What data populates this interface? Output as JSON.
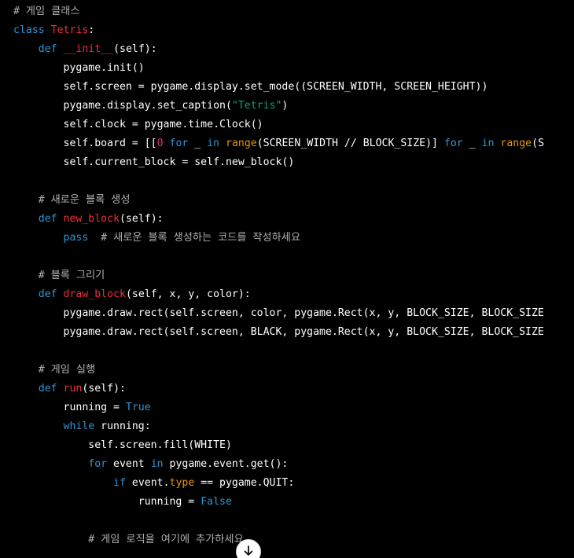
{
  "colors": {
    "background": "#000000",
    "default": "#ffffff",
    "comment": "#b0b0b0",
    "keyword": "#2e95d3",
    "class": "#f22c3d",
    "function": "#f22c3d",
    "string": "#00a67d",
    "number": "#df3079",
    "builtin": "#e9950c"
  },
  "scroll_button": {
    "icon": "arrow-down-icon"
  },
  "code": {
    "language": "python",
    "lines": [
      [
        {
          "t": "comment",
          "s": "# 게임 클래스"
        }
      ],
      [
        {
          "t": "keyword",
          "s": "class"
        },
        {
          "t": "default",
          "s": " "
        },
        {
          "t": "class",
          "s": "Tetris"
        },
        {
          "t": "default",
          "s": ":"
        }
      ],
      [
        {
          "t": "default",
          "s": "    "
        },
        {
          "t": "keyword",
          "s": "def"
        },
        {
          "t": "default",
          "s": " "
        },
        {
          "t": "func",
          "s": "__init__"
        },
        {
          "t": "default",
          "s": "(self):"
        }
      ],
      [
        {
          "t": "default",
          "s": "        pygame.init()"
        }
      ],
      [
        {
          "t": "default",
          "s": "        self.screen = pygame.display.set_mode((SCREEN_WIDTH, SCREEN_HEIGHT))"
        }
      ],
      [
        {
          "t": "default",
          "s": "        pygame.display.set_caption("
        },
        {
          "t": "string",
          "s": "\"Tetris\""
        },
        {
          "t": "default",
          "s": ")"
        }
      ],
      [
        {
          "t": "default",
          "s": "        self.clock = pygame.time.Clock()"
        }
      ],
      [
        {
          "t": "default",
          "s": "        self.board = [["
        },
        {
          "t": "number",
          "s": "0"
        },
        {
          "t": "default",
          "s": " "
        },
        {
          "t": "keyword",
          "s": "for"
        },
        {
          "t": "default",
          "s": " _ "
        },
        {
          "t": "keyword",
          "s": "in"
        },
        {
          "t": "default",
          "s": " "
        },
        {
          "t": "builtin",
          "s": "range"
        },
        {
          "t": "default",
          "s": "(SCREEN_WIDTH // BLOCK_SIZE)] "
        },
        {
          "t": "keyword",
          "s": "for"
        },
        {
          "t": "default",
          "s": " _ "
        },
        {
          "t": "keyword",
          "s": "in"
        },
        {
          "t": "default",
          "s": " "
        },
        {
          "t": "builtin",
          "s": "range"
        },
        {
          "t": "default",
          "s": "(S"
        }
      ],
      [
        {
          "t": "default",
          "s": "        self.current_block = self.new_block()"
        }
      ],
      [
        {
          "t": "default",
          "s": ""
        }
      ],
      [
        {
          "t": "default",
          "s": "    "
        },
        {
          "t": "comment",
          "s": "# 새로운 블록 생성"
        }
      ],
      [
        {
          "t": "default",
          "s": "    "
        },
        {
          "t": "keyword",
          "s": "def"
        },
        {
          "t": "default",
          "s": " "
        },
        {
          "t": "func",
          "s": "new_block"
        },
        {
          "t": "default",
          "s": "(self):"
        }
      ],
      [
        {
          "t": "default",
          "s": "        "
        },
        {
          "t": "keyword",
          "s": "pass"
        },
        {
          "t": "default",
          "s": "  "
        },
        {
          "t": "comment",
          "s": "# 새로운 블록 생성하는 코드를 작성하세요"
        }
      ],
      [
        {
          "t": "default",
          "s": ""
        }
      ],
      [
        {
          "t": "default",
          "s": "    "
        },
        {
          "t": "comment",
          "s": "# 블록 그리기"
        }
      ],
      [
        {
          "t": "default",
          "s": "    "
        },
        {
          "t": "keyword",
          "s": "def"
        },
        {
          "t": "default",
          "s": " "
        },
        {
          "t": "func",
          "s": "draw_block"
        },
        {
          "t": "default",
          "s": "(self, x, y, color):"
        }
      ],
      [
        {
          "t": "default",
          "s": "        pygame.draw.rect(self.screen, color, pygame.Rect(x, y, BLOCK_SIZE, BLOCK_SIZE"
        }
      ],
      [
        {
          "t": "default",
          "s": "        pygame.draw.rect(self.screen, BLACK, pygame.Rect(x, y, BLOCK_SIZE, BLOCK_SIZE"
        }
      ],
      [
        {
          "t": "default",
          "s": ""
        }
      ],
      [
        {
          "t": "default",
          "s": "    "
        },
        {
          "t": "comment",
          "s": "# 게임 실행"
        }
      ],
      [
        {
          "t": "default",
          "s": "    "
        },
        {
          "t": "keyword",
          "s": "def"
        },
        {
          "t": "default",
          "s": " "
        },
        {
          "t": "func",
          "s": "run"
        },
        {
          "t": "default",
          "s": "(self):"
        }
      ],
      [
        {
          "t": "default",
          "s": "        running = "
        },
        {
          "t": "keyword",
          "s": "True"
        }
      ],
      [
        {
          "t": "default",
          "s": "        "
        },
        {
          "t": "keyword",
          "s": "while"
        },
        {
          "t": "default",
          "s": " running:"
        }
      ],
      [
        {
          "t": "default",
          "s": "            self.screen.fill(WHITE)"
        }
      ],
      [
        {
          "t": "default",
          "s": "            "
        },
        {
          "t": "keyword",
          "s": "for"
        },
        {
          "t": "default",
          "s": " event "
        },
        {
          "t": "keyword",
          "s": "in"
        },
        {
          "t": "default",
          "s": " pygame.event.get():"
        }
      ],
      [
        {
          "t": "default",
          "s": "                "
        },
        {
          "t": "keyword",
          "s": "if"
        },
        {
          "t": "default",
          "s": " event."
        },
        {
          "t": "builtin",
          "s": "type"
        },
        {
          "t": "default",
          "s": " == pygame.QUIT:"
        }
      ],
      [
        {
          "t": "default",
          "s": "                    running = "
        },
        {
          "t": "keyword",
          "s": "False"
        }
      ],
      [
        {
          "t": "default",
          "s": ""
        }
      ],
      [
        {
          "t": "default",
          "s": "            "
        },
        {
          "t": "comment",
          "s": "# 게임 로직을 여기에 추가하세요"
        }
      ]
    ]
  }
}
